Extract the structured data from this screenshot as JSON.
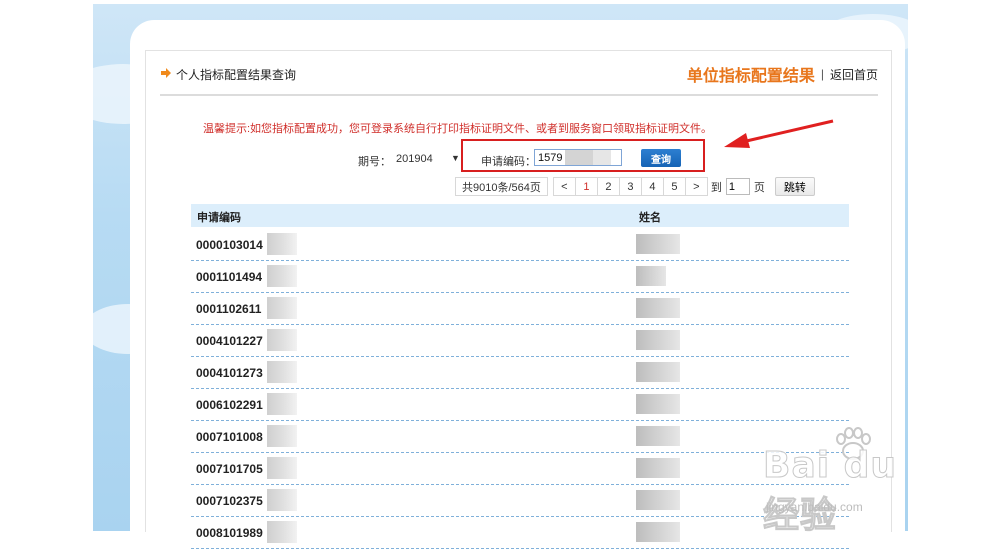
{
  "header": {
    "title": "个人指标配置结果查询",
    "result_title": "单位指标配置结果",
    "separator": "|",
    "home_link": "返回首页"
  },
  "tip": "温馨提示:如您指标配置成功，您可登录系统自行打印指标证明文件、或者到服务窗口领取指标证明文件。",
  "query": {
    "period_label": "期号：",
    "period_value": "201904",
    "code_label": "申请编码：",
    "code_value": "1579",
    "button_label": "查询"
  },
  "pager": {
    "total": "共9010条/564页",
    "prev": "<",
    "pages": [
      "1",
      "2",
      "3",
      "4",
      "5"
    ],
    "active_page": "1",
    "next": ">",
    "goto_prefix": "到",
    "goto_value": "1",
    "goto_suffix": "页",
    "jump_label": "跳转"
  },
  "table": {
    "headers": {
      "code": "申请编码",
      "name": "姓名"
    },
    "rows": [
      {
        "code": "0000103014"
      },
      {
        "code": "0001101494"
      },
      {
        "code": "0001102611"
      },
      {
        "code": "0004101227"
      },
      {
        "code": "0004101273"
      },
      {
        "code": "0006102291"
      },
      {
        "code": "0007101008"
      },
      {
        "code": "0007101705"
      },
      {
        "code": "0007102375"
      },
      {
        "code": "0008101989"
      }
    ]
  },
  "watermark": {
    "text": "Bai du 经验",
    "url": "jingyan.baidu.com"
  },
  "colors": {
    "accent_orange": "#e8761c",
    "tip_red": "#d0302c",
    "highlight_red": "#d81f1f",
    "button_blue": "#1563b5",
    "table_head_bg": "#dceefb"
  }
}
